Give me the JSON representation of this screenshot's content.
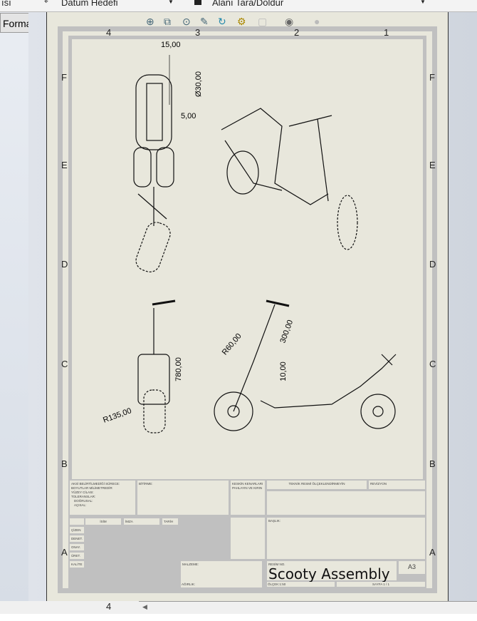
{
  "toolbar": {
    "left_label": "ısı",
    "datum_label": "Datum Hedefi",
    "hatch_label": "Alanı Tara/Doldur"
  },
  "tab": {
    "label": "Formatı"
  },
  "view_icons": [
    "zoom-to-fit-icon",
    "zoom-area-icon",
    "zoom-in-out-icon",
    "pan-icon",
    "rotate-icon",
    "section-view-icon",
    "display-style-icon",
    "hide-show-icon",
    "appearance-icon"
  ],
  "zones": {
    "columns": [
      "4",
      "3",
      "2",
      "1"
    ],
    "rows": [
      "F",
      "E",
      "D",
      "C",
      "B",
      "A"
    ]
  },
  "dimensions": {
    "d1": "15,00",
    "d2": "Ø30,00",
    "d3": "5,00",
    "d4": "780,00",
    "d5": "R135,00",
    "d6": "R60,00",
    "d7": "300,00",
    "d8": "10,00"
  },
  "title_block": {
    "notes": [
      "AKSİ BELİRTİLMEDİĞİ SÜRECE:",
      "BOYUTLAR MİLİMETREDİR",
      "YÜZEY CİLASI:",
      "TOLERANSLAR:",
      "DOĞRUSAL:",
      "AÇISAL:"
    ],
    "finish": "BİTİRME:",
    "edges": "KESKİN KENARLARI PAHLAYIN VE KIRIN",
    "no_scale": "TEKNİK RESMİ ÖLÇEKLENDİRMEYİN",
    "revision": "REVİZYON",
    "headers": [
      "İSİM",
      "İMZA",
      "TARİH"
    ],
    "roles": [
      "ÇİZEN",
      "DENET.",
      "ONAY.",
      "ÜRET.",
      "KALİTE"
    ],
    "material": "MALZEME:",
    "weight": "AĞIRLIK:",
    "title": "BAŞLIK:",
    "drawing_no_label": "RESİM NO.",
    "drawing_no": "Scooty Assembly",
    "size": "A3",
    "scale": "ÖLÇEK:1:50",
    "sheet": "SAYFA 1 / 1"
  }
}
